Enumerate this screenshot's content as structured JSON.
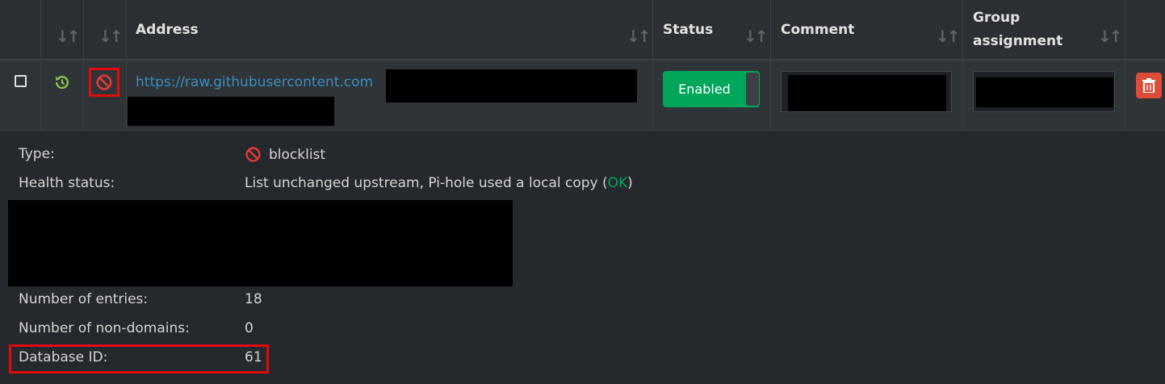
{
  "table": {
    "columns": {
      "address": "Address",
      "status": "Status",
      "comment": "Comment",
      "group_line1": "Group",
      "group_line2": "assignment"
    },
    "sort_icon": "sort-icon"
  },
  "row": {
    "address_link": "https://raw.githubusercontent.com",
    "status_toggle": "Enabled",
    "icons": [
      "checkbox-icon",
      "history-icon",
      "block-icon",
      "trash-icon"
    ]
  },
  "details": {
    "type_label": "Type:",
    "type_value": "blocklist",
    "health_label": "Health status:",
    "health_value": "List unchanged upstream, Pi-hole used a local copy (",
    "health_ok": "OK",
    "health_close": ")",
    "entries_label": "Number of entries:",
    "entries_value": "18",
    "nondomains_label": "Number of non-domains:",
    "nondomains_value": "0",
    "dbid_label": "Database ID:",
    "dbid_value": "61"
  },
  "colors": {
    "background": "#2b2f33",
    "link": "#3c8dbc",
    "enabled": "#00a65a",
    "danger": "#dd4b39",
    "highlight": "#e10b0b"
  }
}
